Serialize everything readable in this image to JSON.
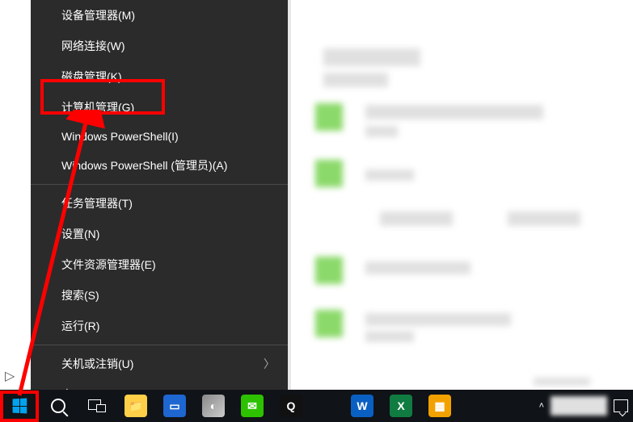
{
  "menu": {
    "items": [
      {
        "label": "设备管理器(M)",
        "has_submenu": false
      },
      {
        "label": "网络连接(W)",
        "has_submenu": false
      },
      {
        "label": "磁盘管理(K)",
        "has_submenu": false
      },
      {
        "label": "计算机管理(G)",
        "has_submenu": false
      },
      {
        "label": "Windows PowerShell(I)",
        "has_submenu": false
      },
      {
        "label": "Windows PowerShell (管理员)(A)",
        "has_submenu": false
      },
      {
        "label": "任务管理器(T)",
        "has_submenu": false
      },
      {
        "label": "设置(N)",
        "has_submenu": false
      },
      {
        "label": "文件资源管理器(E)",
        "has_submenu": false
      },
      {
        "label": "搜索(S)",
        "has_submenu": false
      },
      {
        "label": "运行(R)",
        "has_submenu": false
      },
      {
        "label": "关机或注销(U)",
        "has_submenu": true
      },
      {
        "label": "桌面(D)",
        "has_submenu": false
      }
    ],
    "separators_after": [
      5,
      10
    ]
  },
  "taskbar": {
    "apps": [
      {
        "name": "file-explorer",
        "bg": "#ffcf48",
        "glyph": "📁"
      },
      {
        "name": "app-blue",
        "bg": "#1e66d0",
        "glyph": "🗔"
      },
      {
        "name": "browser",
        "bg": "#6b6b6b",
        "glyph": "🌐"
      },
      {
        "name": "wechat",
        "bg": "#2dc100",
        "glyph": "💬"
      },
      {
        "name": "qq",
        "bg": "#2b2b2b",
        "glyph": "🐧"
      },
      {
        "name": "wps",
        "bg": "#d83b01",
        "glyph": "W"
      },
      {
        "name": "excel",
        "bg": "#107c41",
        "glyph": "X"
      },
      {
        "name": "app-yellow",
        "bg": "#f2a100",
        "glyph": "📒"
      }
    ]
  },
  "annotation": {
    "highlighted_item_index": 3,
    "arrow_from": "start-button",
    "arrow_to": "computer-management"
  }
}
